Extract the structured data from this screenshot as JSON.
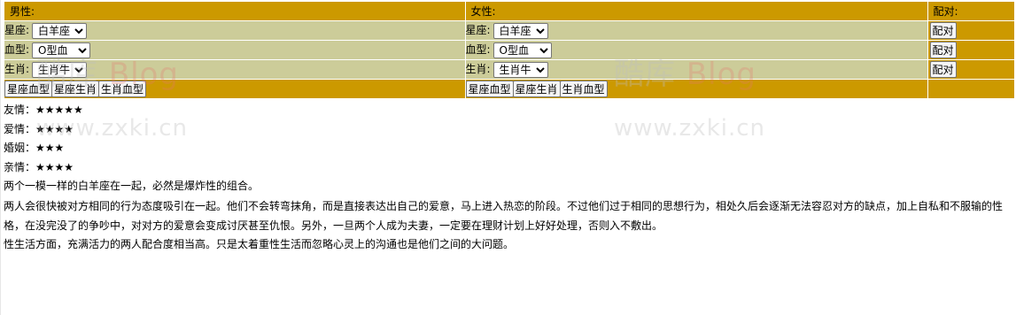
{
  "header": {
    "male_label": "男性:",
    "female_label": "女性:",
    "pair_label": "配对:"
  },
  "rows": {
    "zodiac_label": "星座:",
    "blood_label": "血型:",
    "sign_label": "生肖:"
  },
  "male": {
    "zodiac_value": "白羊座",
    "blood_value": "O型血",
    "sign_value": "生肖牛"
  },
  "female": {
    "zodiac_value": "白羊座",
    "blood_value": "O型血",
    "sign_value": "生肖牛"
  },
  "buttons": {
    "pair": "配对",
    "zodiac_blood": "星座血型",
    "zodiac_sign": "星座生肖",
    "sign_blood": "生肖血型"
  },
  "results": {
    "friendship": "友情：★★★★★",
    "love": "爱情：★★★★",
    "marriage": "婚姻：★★★",
    "family": "亲情：★★★★",
    "summary": "两个一模一样的白羊座在一起，必然是爆炸性的组合。",
    "description": "两人会很快被对方相同的行为态度吸引在一起。他们不会转弯抹角，而是直接表达出自己的爱意，马上进入热恋的阶段。不过他们过于相同的思想行为，相处久后会逐渐无法容忍对方的缺点，加上自私和不服输的性格，在没完没了的争吵中，对对方的爱意会变成讨厌甚至仇恨。另外，一旦两个人成为夫妻，一定要在理财计划上好好处理，否则入不敷出。",
    "sexual": "性生活方面，充满活力的两人配合度相当高。只是太着重性生活而忽略心灵上的沟通也是他们之间的大问题。"
  },
  "watermarks": {
    "logo_cn": "酷库",
    "logo_en": "Blog",
    "url": "www.zxki.cn"
  },
  "colors": {
    "header_bg": "#cc9900",
    "row_bg": "#cccc99"
  }
}
